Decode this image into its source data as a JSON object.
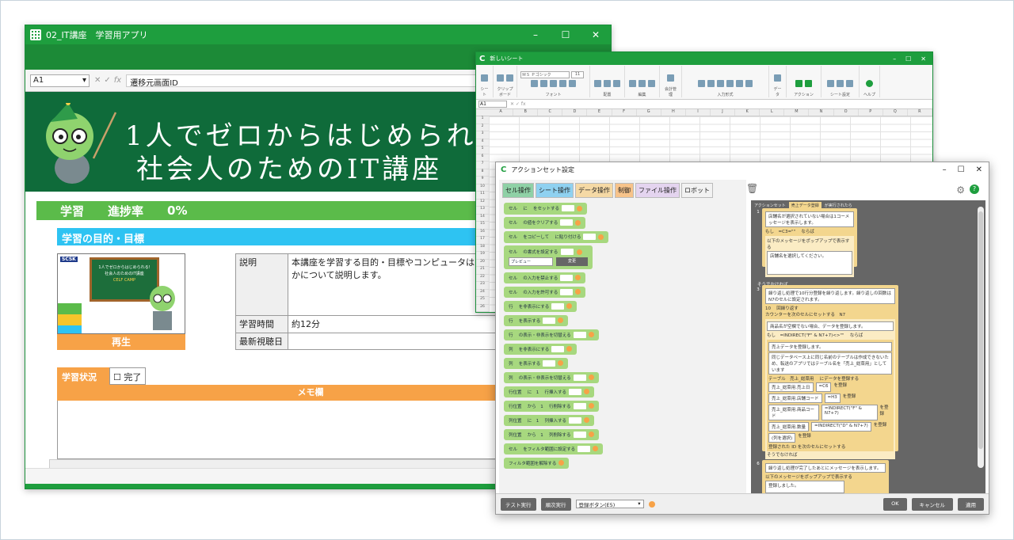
{
  "main_window": {
    "title": "02_IT講座　学習用アプリ",
    "controls": [
      "–",
      "☐",
      "✕"
    ],
    "name_box": "A1",
    "formula": "遷移元画面ID",
    "banner_line1": "1人でゼロからはじめられる",
    "banner_line2": "社会人のためのIT講座",
    "progress_label": "学習",
    "progress_rate_label": "進捗率",
    "progress_value": "0%",
    "goal_title": "学習の目的・目標",
    "thumb_brand": "SCSK",
    "thumb_text1": "1人でゼロからはじめられる!",
    "thumb_text2": "社会人のためのIT講座",
    "thumb_text3": "CELF CAMP",
    "play_label": "再生",
    "info": [
      {
        "key": "説明",
        "value": "本講座を学習する目的・目標やコンピュータはなぜ動くのかについて説明します。"
      },
      {
        "key": "学習時間",
        "value": "約12分"
      },
      {
        "key": "最新視聴日",
        "value": ""
      }
    ],
    "status_label": "学習状況",
    "status_check": "☐ 完了",
    "memo_label": "メモ欄"
  },
  "sheet_window": {
    "title": "新しいシート",
    "ribbon_groups": [
      "シート",
      "クリップボード",
      "フォント",
      "配置",
      "編集",
      "会計管理",
      "入力形式",
      "データ",
      "アクション",
      "シート設定",
      "ヘルプ"
    ],
    "font_name": "ＭＳ Ｐゴシック",
    "font_size": "11",
    "name_box": "A1",
    "columns": [
      "A",
      "B",
      "C",
      "D",
      "E",
      "F",
      "G",
      "H",
      "I",
      "J",
      "K",
      "L",
      "M",
      "N",
      "O",
      "P",
      "Q",
      "R"
    ],
    "rows": [
      "1",
      "2",
      "3",
      "4",
      "5",
      "6",
      "7",
      "8",
      "9",
      "10",
      "11",
      "12",
      "13",
      "14",
      "15",
      "16",
      "17",
      "18",
      "19",
      "20",
      "21",
      "22",
      "23",
      "24",
      "25",
      "26"
    ]
  },
  "dialog": {
    "title": "アクションセット設定",
    "tabs": [
      "セル操作",
      "シート操作",
      "データ操作",
      "制御",
      "ファイル操作",
      "ロボット"
    ],
    "blocks": [
      "セル　 に　 をセットする",
      "セル　 の値をクリアする",
      "セル　 をコピーして　 に貼り付ける",
      "セル　 の書式を設定する",
      "セル　 の入力を禁止する",
      "セル　 の入力を許可する",
      "行　 を非表示にする",
      "行　 を表示する",
      "行　 の表示・非表示を切替える",
      "列　 を非表示にする",
      "列　 を表示する",
      "列　 の表示・非表示を切替える",
      "行位置　 に　1　 行挿入する",
      "行位置　 から　1　 行削除する",
      "列位置　 に　1　 列挿入する",
      "列位置　 から　1　 列削除する",
      "セル　 をフィルタ範囲に設定する",
      "フィルタ範囲を解除する"
    ],
    "preview_label": "プレビュー",
    "change_label": "変更",
    "script_head": [
      "アクションセット",
      "売上データ登録",
      "が実行されたら"
    ],
    "script": {
      "s1": "店舗名が選択されていない場合は1コーメッセージを表示します。",
      "s1_cond": "もし　=C3=\"\"　 ならば",
      "s1_popup": "以下のメッセージをポップアップで表示する",
      "s1_msg": "店舗名を選択してください。",
      "else": "そうでなければ",
      "s3": "繰り返し処理で10行分登録を繰り返します。繰り返しの回数はN7のセルに設定されます。",
      "s3_loop": "10　 回繰り返す",
      "s3_counter": "カウンターを次のセルにセットする　N7",
      "s4": "商品名が空欄でない場合、データを登録します。",
      "s4_cond": "もし　=INDIRECT(\"F\" & N7+7)<>\"\"　 ならば",
      "s5": "売上データを登録します。",
      "s5_note": "同じデータベース上に同じ名前のテーブルは作成できないため、転送のアプリではテーブル名を「売上_総菜用」としています",
      "table_label": "テーブル　売上_総菜用　 にデータを登録する",
      "f1": "売上_総菜用.売上日",
      "v1": "=C6",
      "f2": "売上_総菜用.店舗コード",
      "v2": "=H3",
      "f3": "売上_総菜用.商品コード",
      "v3": "=INDIRECT(\"F\" & N7+7)",
      "f4": "売上_総菜用.数量",
      "v4": "=INDIRECT(\"D\" & N7+7)",
      "f5": "(列を選択)",
      "reg": "を登録",
      "id_note": "登録された ID を次のセルにセットする",
      "else2": "そうでなければ",
      "s6": "繰り返し処理が完了したあとにメッセージを表示します。",
      "s6_popup": "以下のメッセージをポップアップで表示する",
      "s6_msg": "登録しました。"
    },
    "footer": {
      "test_run": "テスト実行",
      "step_run": "順次実行",
      "select_value": "登録ボタン(E5)",
      "ok": "OK",
      "cancel": "キャンセル",
      "apply": "適用"
    }
  }
}
